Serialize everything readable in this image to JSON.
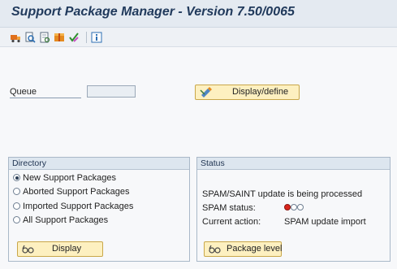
{
  "window": {
    "title": "Support Package Manager - Version 7.50/0065"
  },
  "toolbar": {
    "icons": [
      "truck-icon",
      "find-icon",
      "document-icon",
      "package-icon",
      "check-icon",
      "info-icon"
    ]
  },
  "queue": {
    "label": "Queue",
    "value": "",
    "button_label": "Display/define"
  },
  "directory": {
    "header": "Directory",
    "options": [
      {
        "label": "New Support Packages",
        "selected": true
      },
      {
        "label": "Aborted Support Packages",
        "selected": false
      },
      {
        "label": "Imported Support Packages",
        "selected": false
      },
      {
        "label": "All Support Packages",
        "selected": false
      }
    ],
    "display_button": "Display"
  },
  "status": {
    "header": "Status",
    "message": "SPAM/SAINT update is being processed",
    "spam_status_label": "SPAM status:",
    "traffic_light": {
      "state": "red",
      "colors": {
        "red": "#d9261c",
        "off": "#ffffff"
      }
    },
    "current_action_label": "Current action:",
    "current_action_value": "SPAM update import",
    "package_level_button": "Package level"
  },
  "colors": {
    "accent_button": "#fdf0c0",
    "title_text": "#213a5c"
  }
}
